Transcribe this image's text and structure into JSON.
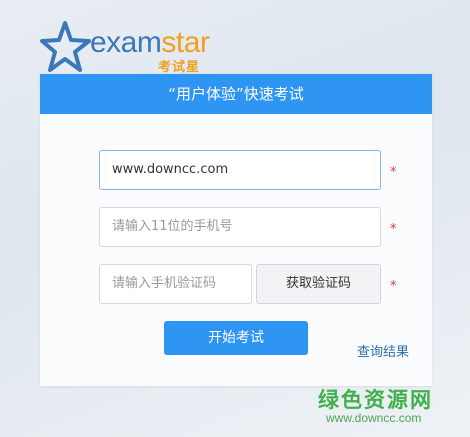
{
  "logo": {
    "brand_part1": "exam",
    "brand_part2": "star",
    "subtitle": "考试星"
  },
  "card": {
    "title": "“用户体验”快速考试"
  },
  "form": {
    "field1_value": "www.downcc.com",
    "phone_placeholder": "请输入11位的手机号",
    "code_placeholder": "请输入手机验证码",
    "get_code_label": "获取验证码",
    "required_mark": "*",
    "start_label": "开始考试",
    "query_link": "查询结果"
  },
  "watermark": {
    "title": "绿色资源网",
    "url": "www.downcc.com"
  },
  "colors": {
    "header": "#2f95f2",
    "button": "#2f95f2",
    "required": "#e0383c",
    "brand_blue": "#3a78b8",
    "brand_orange": "#f0a020"
  }
}
